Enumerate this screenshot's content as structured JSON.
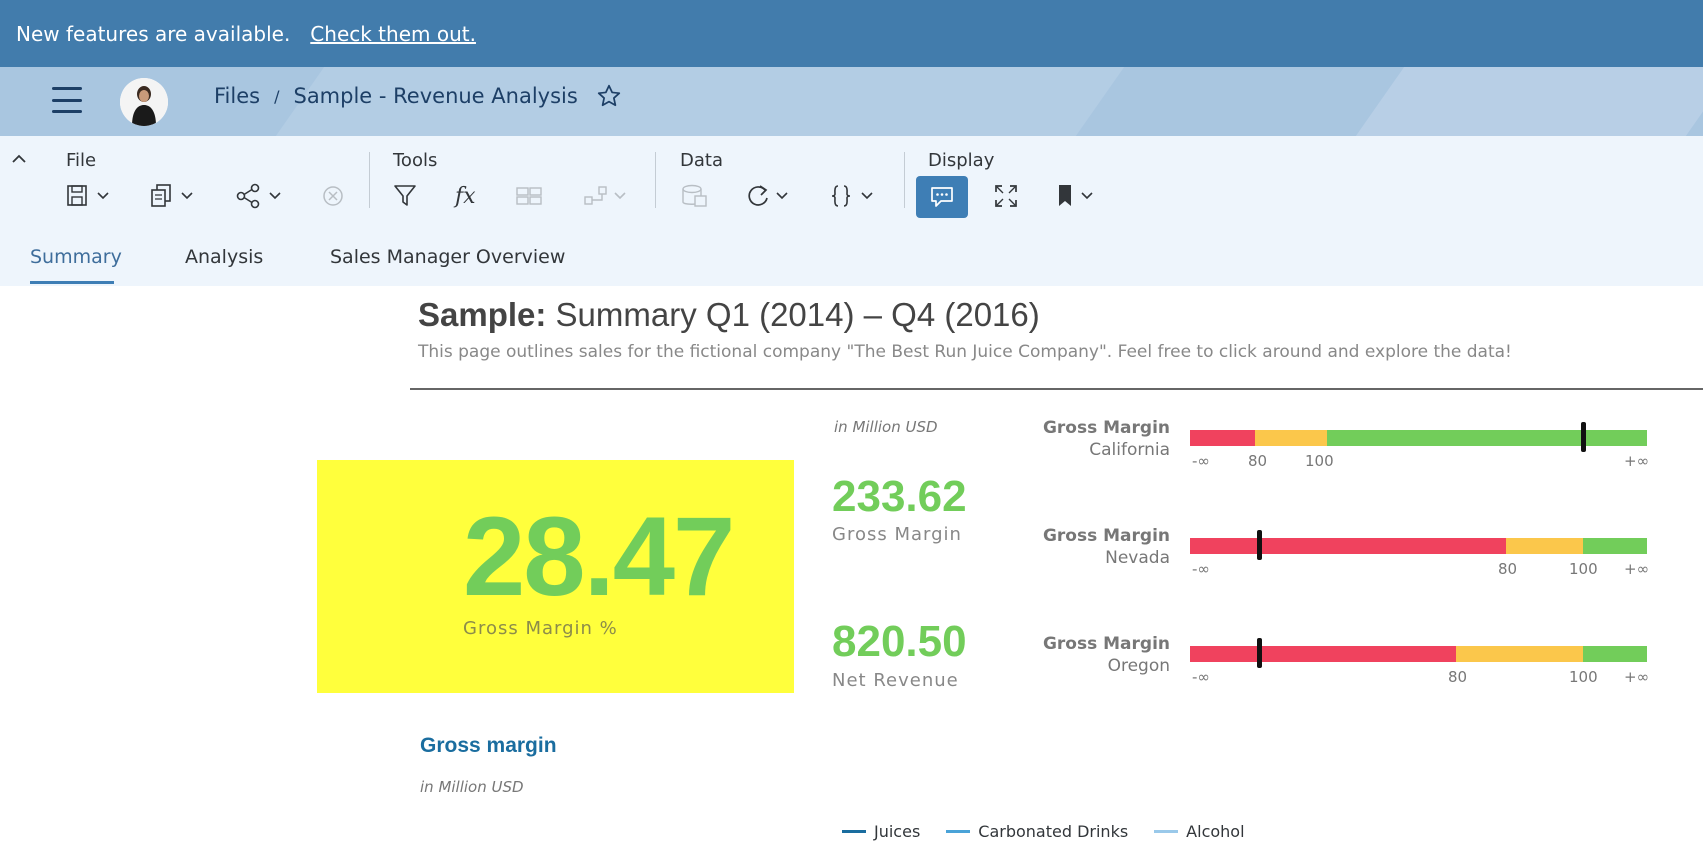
{
  "notification": {
    "text": "New features are available.",
    "link": "Check them out."
  },
  "shell": {
    "breadcrumb": {
      "root": "Files",
      "separator": "/",
      "current": "Sample - Revenue Analysis"
    }
  },
  "toolbar": {
    "groups": {
      "file": "File",
      "tools": "Tools",
      "data": "Data",
      "display": "Display"
    },
    "icons": [
      "save-icon",
      "copy-icon",
      "share-icon",
      "discard-icon",
      "filter-icon",
      "formula-icon",
      "input-control-icon",
      "link-dimensions-icon",
      "data-source-icon",
      "refresh-icon",
      "script-icon",
      "comment-icon",
      "fullscreen-icon",
      "bookmark-icon"
    ]
  },
  "tabs": [
    {
      "label": "Summary",
      "active": true
    },
    {
      "label": "Analysis"
    },
    {
      "label": "Sales Manager Overview"
    }
  ],
  "page": {
    "title_bold": "Sample:",
    "title_rest": "Summary Q1 (2014) – Q4 (2016)",
    "subtitle": "This page outlines sales for the fictional company \"The Best Run Juice Company\". Feel free to click around and explore the data!"
  },
  "kpi_main": {
    "value": "28.47",
    "label": "Gross Margin %",
    "background": "#ffff3c",
    "color": "#72cd5a"
  },
  "unit_label": "in Million USD",
  "kpis": [
    {
      "value": "233.62",
      "label": "Gross Margin"
    },
    {
      "value": "820.50",
      "label": "Net Revenue"
    }
  ],
  "bullets": [
    {
      "title": "Gross Margin",
      "region": "California",
      "ticks": [
        "-∞",
        "80",
        "100",
        "+∞"
      ],
      "marker_fraction": 0.86
    },
    {
      "title": "Gross Margin",
      "region": "Nevada",
      "ticks": [
        "-∞",
        "80",
        "100",
        "+∞"
      ],
      "marker_fraction": 0.15
    },
    {
      "title": "Gross Margin",
      "region": "Oregon",
      "ticks": [
        "-∞",
        "80",
        "100",
        "+∞"
      ],
      "marker_fraction": 0.15
    }
  ],
  "bullet_colors": {
    "bad": "#f0425e",
    "warn": "#fbc74b",
    "good": "#72cd5a"
  },
  "gross_margin_chart": {
    "title": "Gross margin",
    "unit": "in Million USD",
    "legend": [
      {
        "name": "Juices",
        "color": "#1a6d9f"
      },
      {
        "name": "Carbonated Drinks",
        "color": "#4aa3d8"
      },
      {
        "name": "Alcohol",
        "color": "#9ac9ea"
      }
    ]
  }
}
